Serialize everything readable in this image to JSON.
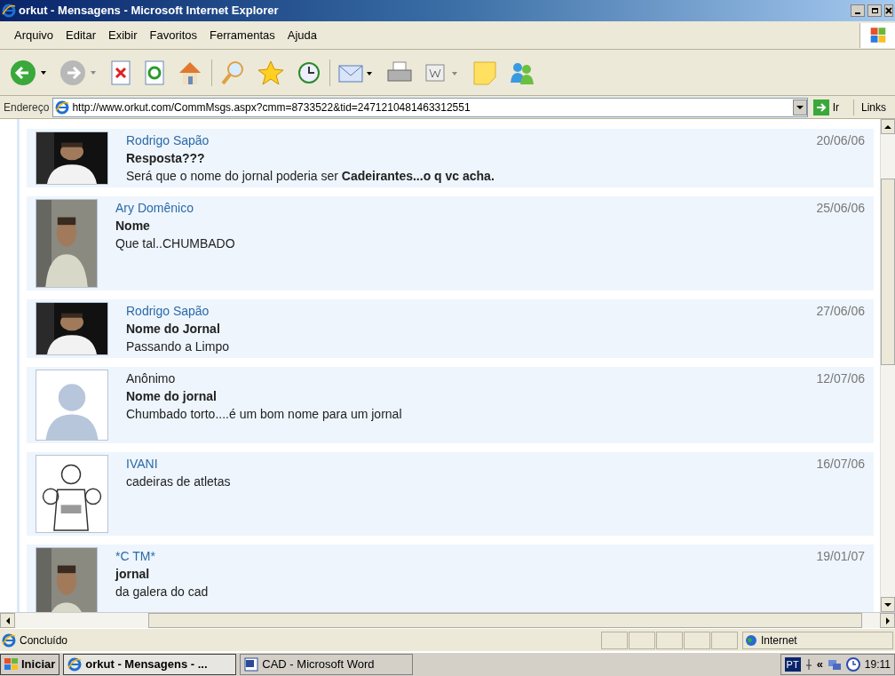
{
  "window": {
    "title": "orkut - Mensagens - Microsoft Internet Explorer"
  },
  "menu": [
    "Arquivo",
    "Editar",
    "Exibir",
    "Favoritos",
    "Ferramentas",
    "Ajuda"
  ],
  "address": {
    "label": "Endereço",
    "value": "http://www.orkut.com/CommMsgs.aspx?cmm=8733522&tid=2471210481463312551",
    "go": "Ir",
    "links": "Links"
  },
  "messages": [
    {
      "author": "Rodrigo Sapão",
      "link": true,
      "subject": "Resposta???",
      "body": "Será que o nome do jornal poderia ser **Cadeirantes...o q vc acha.**",
      "date": "20/06/06"
    },
    {
      "author": "Ary Domênico",
      "link": true,
      "avatar": {
        "kind": "portrait"
      },
      "subject": "Nome",
      "body": "Que tal..CHUMBADO",
      "date": "25/06/06"
    },
    {
      "author": "Rodrigo Sapão",
      "link": true,
      "subject": "Nome do Jornal",
      "body": "Passando a Limpo",
      "date": "27/06/06"
    },
    {
      "author": "Anônimo",
      "link": false,
      "avatar": {
        "kind": "silhouette"
      },
      "subject": "Nome do jornal",
      "body": "Chumbado torto....é um bom nome para um jornal",
      "date": "12/07/06"
    },
    {
      "author": "IVANI",
      "link": true,
      "avatar": {
        "kind": "sketch"
      },
      "body": "cadeiras de atletas",
      "date": "16/07/06"
    },
    {
      "author": "*C TM*",
      "link": true,
      "avatar": {
        "kind": "portrait"
      },
      "subject": "jornal",
      "body": "da galera do cad",
      "date": "19/01/07"
    }
  ],
  "status_bar": {
    "text": "Concluído",
    "zone": "Internet"
  },
  "taskbar": {
    "start": "Iniciar",
    "windows": [
      {
        "label": "orkut - Mensagens - ...",
        "selected": true,
        "kind": "ie"
      },
      {
        "label": "CAD - Microsoft Word",
        "selected": false,
        "kind": "word"
      }
    ],
    "language": "PT",
    "tray_chevron": "«",
    "clock": "19:11"
  }
}
